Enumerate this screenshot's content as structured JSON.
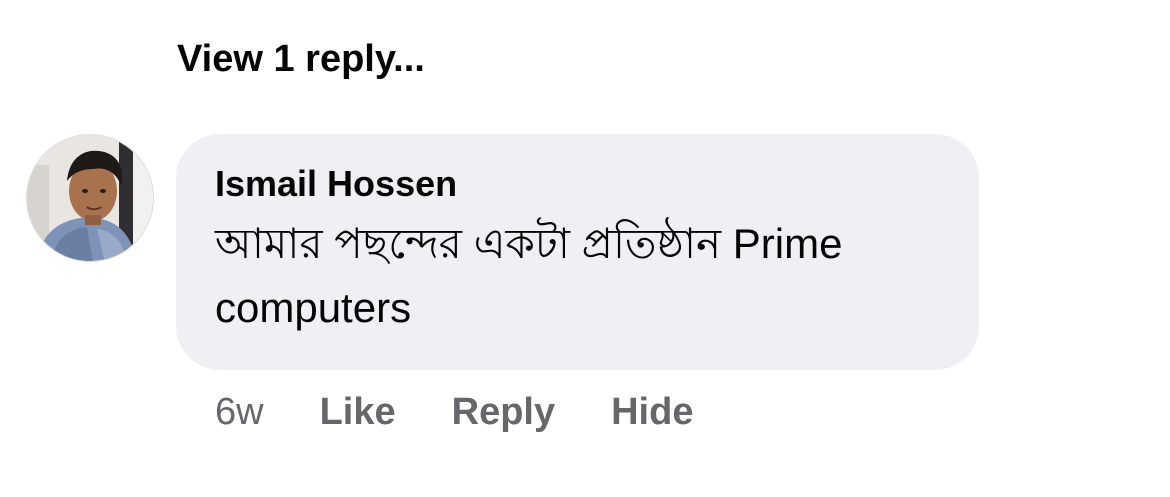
{
  "thread": {
    "view_replies_label": "View 1 reply..."
  },
  "comment": {
    "author": "Ismail Hossen",
    "text": "আমার পছন্দের একটা প্রতিষ্ঠান Prime computers",
    "avatar_icon": "user-photo-avatar",
    "bubble_color": "#f0f0f4",
    "timestamp": "6w",
    "actions": {
      "like": "Like",
      "reply": "Reply",
      "hide": "Hide"
    }
  }
}
